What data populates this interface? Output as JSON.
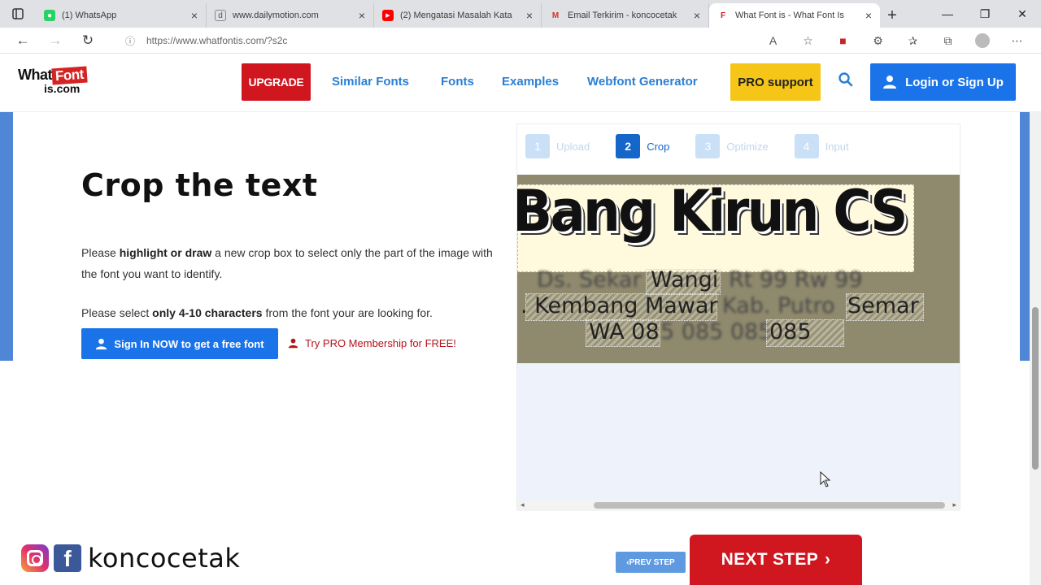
{
  "browser": {
    "tabs": [
      {
        "title": "(1) WhatsApp",
        "icon": "whatsapp-icon",
        "color": "#25d366"
      },
      {
        "title": "www.dailymotion.com",
        "icon": "dailymotion-icon",
        "color": "#666666"
      },
      {
        "title": "(2) Mengatasi Masalah Kata",
        "icon": "youtube-icon",
        "color": "#ff0000"
      },
      {
        "title": "Email Terkirim - koncocetak",
        "icon": "gmail-icon",
        "color": "#d93025"
      },
      {
        "title": "What Font is - What Font Is",
        "icon": "whatfontis-icon",
        "color": "#d32323"
      }
    ],
    "url": "https://www.whatfontis.com/?s2c"
  },
  "header": {
    "logo_top": "What",
    "logo_font": "Font",
    "logo_bottom": "is.com",
    "upgrade": "UPGRADE",
    "nav": [
      "Similar Fonts",
      "Fonts",
      "Examples",
      "Webfont Generator"
    ],
    "pro_support": "PRO support",
    "login": "Login or Sign Up"
  },
  "main": {
    "title": "Crop the text",
    "para1_pre": "Please ",
    "para1_bold": "highlight or draw",
    "para1_post": " a new crop box to select only the part of the image with the font you want to identify.",
    "para2_pre": "Please select ",
    "para2_bold": "only 4-10 characters",
    "para2_post": " from the font your are looking for.",
    "signin_button": "Sign In NOW to get a free font",
    "try_pro": "Try PRO Membership for FREE!"
  },
  "steps": [
    {
      "num": "1",
      "label": "Upload",
      "active": false
    },
    {
      "num": "2",
      "label": "Crop",
      "active": true
    },
    {
      "num": "3",
      "label": "Optimize",
      "active": false
    },
    {
      "num": "4",
      "label": "Input",
      "active": false
    }
  ],
  "image": {
    "headline": "Bang Kirun CS",
    "line1_a": "Ds. Sekar",
    "line1_b": "Wangi",
    "line1_c": "Rt 99 Rw 99",
    "line2_a": ". Kembang Mawar",
    "line2_b": "Kab. Putro",
    "line2_c": "Semar",
    "line3_a": "WA 08",
    "line3_b": "5 085 085",
    "line3_c": "085"
  },
  "bottom": {
    "brand": "koncocetak",
    "prev_step": "PREV STEP",
    "next_step": "NEXT STEP"
  },
  "colors": {
    "accent_blue": "#1a73e8",
    "upgrade_red": "#d0161f",
    "pro_yellow": "#f5c518",
    "nav_blue": "#2a7fd4"
  }
}
